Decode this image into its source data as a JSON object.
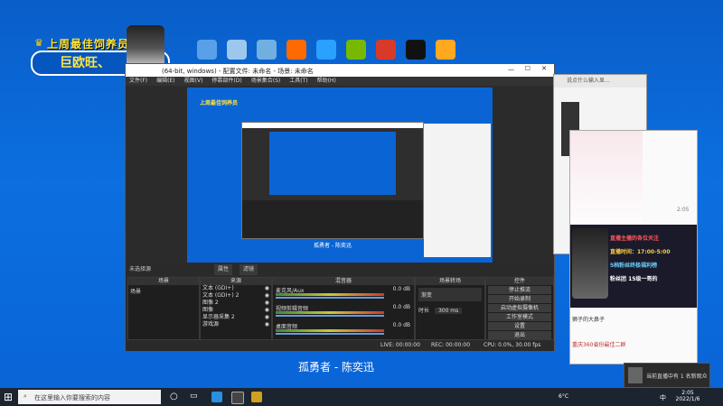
{
  "desktop": {
    "banner_title": "上周最佳饲养员",
    "banner_name": "巨欧旺、",
    "icons": [
      {
        "name": "computer-icon",
        "color": "#5aa0e8"
      },
      {
        "name": "recycle-bin-icon",
        "color": "#9cc8ee"
      },
      {
        "name": "network-icon",
        "color": "#6fb0e0"
      },
      {
        "name": "tools-icon",
        "color": "#ff6a00"
      },
      {
        "name": "installer-icon",
        "color": "#2aa0ff"
      },
      {
        "name": "nvidia-icon",
        "color": "#76b900"
      },
      {
        "name": "game-icon",
        "color": "#d83a2a"
      },
      {
        "name": "qq-icon",
        "color": "#111111"
      },
      {
        "name": "shield-icon",
        "color": "#ffa820"
      }
    ]
  },
  "obs": {
    "title": "(64-bit, windows) - 配置文件: 未命名 - 场景: 未命名",
    "menu": [
      "文件(F)",
      "编辑(E)",
      "视图(V)",
      "停靠部件(D)",
      "场景集合(S)",
      "工具(T)",
      "帮助(H)"
    ],
    "source_bar": "未选择源",
    "source_buttons": [
      "属性",
      "滤镜"
    ],
    "docks": {
      "scenes": "场景",
      "sources": "来源",
      "mixer": "混音器",
      "transitions": "场景转场",
      "controls": "控件"
    },
    "scene_items": [
      "场景"
    ],
    "source_items": [
      "文本 (GDI+)",
      "文本 (GDI+) 2",
      "图像 2",
      "图像",
      "显示器采集 2",
      "游戏源"
    ],
    "mixer_tracks": [
      {
        "name": "麦克风/Aux",
        "db": "0.0 dB"
      },
      {
        "name": "视频剪辑音频",
        "db": "0.0 dB"
      },
      {
        "name": "桌面音频",
        "db": "0.0 dB"
      }
    ],
    "transition": {
      "type": "渐变",
      "duration_label": "时长",
      "duration": "300 ms"
    },
    "controls": [
      "停止推流",
      "开始录制",
      "启动虚拟摄像机",
      "工作室模式",
      "设置",
      "退出"
    ],
    "status": {
      "live": "LIVE: 00:00:00",
      "rec": "REC: 00:00:00",
      "cpu": "CPU: 0.0%, 30.00 fps"
    },
    "preview_caption": "孤勇者 - 陈奕迅"
  },
  "chat": {
    "input_placeholder": "说点什么吧...",
    "header_text": "说点什么输入显...",
    "promo_lines": [
      "直播主播的各位关注",
      "直播时间：17:00-5:00",
      "5档粉丝终极福利榜",
      "粉丝团 15级一哥的"
    ],
    "times": [
      "2:05",
      "2:05",
      "2:05"
    ],
    "user_msgs": [
      "狮子的大鼻子",
      "重庆360省份最佳二群"
    ],
    "right_numbers": [
      "2:05",
      "2:05"
    ]
  },
  "song_caption": "孤勇者 - 陈奕迅",
  "notification": "当前直播中有 1 名新观众",
  "taskbar": {
    "search_placeholder": "在这里输入你要搜索的内容",
    "temp": "6°C",
    "time": "2:05",
    "date": "2022/1/6",
    "lang": "中"
  }
}
